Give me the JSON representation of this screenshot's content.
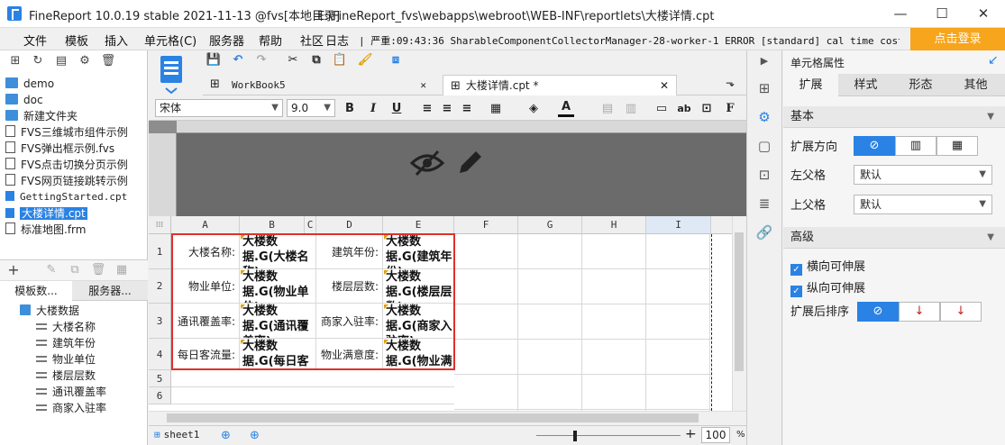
{
  "window": {
    "title": "FineReport 10.0.19 stable 2021-11-13 @fvs[本地目录]",
    "path": "E:\\FineReport_fvs\\webapps\\webroot\\WEB-INF\\reportlets\\大楼详情.cpt",
    "minimize": "—",
    "maximize": "☐",
    "close": "✕"
  },
  "menu": {
    "items": [
      "文件",
      "模板",
      "插入",
      "单元格(C)",
      "服务器",
      "帮助",
      "社区",
      "日志"
    ],
    "log": "| 严重:09:43:36 SharableComponentCollectorManager-28-worker-1 ERROR [standard] cal time cost...",
    "login": "点击登录"
  },
  "file_tree": {
    "items": [
      {
        "label": "demo",
        "type": "folder"
      },
      {
        "label": "doc",
        "type": "folder"
      },
      {
        "label": "新建文件夹",
        "type": "folder"
      },
      {
        "label": "FVS三维城市组件示例",
        "type": "file"
      },
      {
        "label": "FVS弹出框示例.fvs",
        "type": "file"
      },
      {
        "label": "FVS点击切换分页示例",
        "type": "file"
      },
      {
        "label": "FVS网页链接跳转示例",
        "type": "file"
      },
      {
        "label": "GettingStarted.cpt",
        "type": "cpt"
      },
      {
        "label": "大楼详情.cpt",
        "type": "cpt",
        "selected": true
      },
      {
        "label": "标准地图.frm",
        "type": "file"
      }
    ]
  },
  "dataset_panel": {
    "tabs": [
      "模板数...",
      "服务器..."
    ],
    "root": "大楼数据",
    "fields": [
      "大楼名称",
      "建筑年份",
      "物业单位",
      "楼层层数",
      "通讯覆盖率",
      "商家入驻率"
    ]
  },
  "doc_tabs": [
    {
      "label": "WorkBook5",
      "active": false
    },
    {
      "label": "大楼详情.cpt *",
      "active": true
    }
  ],
  "format": {
    "font": "宋体",
    "size": "9.0",
    "bold": "B",
    "italic": "I",
    "underline": "U"
  },
  "grid": {
    "columns": [
      "A",
      "B",
      "C",
      "D",
      "E",
      "F",
      "G",
      "H",
      "I"
    ],
    "rows": [
      "1",
      "2",
      "3",
      "4",
      "5",
      "6"
    ],
    "cells": [
      {
        "label_a": "大楼名称:",
        "formula_b": "大楼数据.G(大楼名称)",
        "label_d": "建筑年份:",
        "formula_e": "大楼数据.G(建筑年份)"
      },
      {
        "label_a": "物业单位:",
        "formula_b": "大楼数据.G(物业单位)",
        "label_d": "楼层层数:",
        "formula_e": "大楼数据.G(楼层层数)"
      },
      {
        "label_a": "通讯覆盖率:",
        "formula_b": "大楼数据.G(通讯覆盖率)",
        "label_d": "商家入驻率:",
        "formula_e": "大楼数据.G(商家入驻率)"
      },
      {
        "label_a": "每日客流量:",
        "formula_b": "大楼数据.G(每日客流量)",
        "label_d": "物业满意度:",
        "formula_e": "大楼数据.G(物业满意度)"
      }
    ]
  },
  "sheet": {
    "name": "sheet1",
    "zoom": "100",
    "zoom_unit": "%",
    "minus": "−",
    "plus": "+"
  },
  "properties": {
    "title": "单元格属性",
    "tabs": [
      "扩展",
      "样式",
      "形态",
      "其他"
    ],
    "basic": "基本",
    "expand_direction": "扩展方向",
    "left_parent": "左父格",
    "left_parent_value": "默认",
    "top_parent": "上父格",
    "top_parent_value": "默认",
    "advanced": "高级",
    "h_stretch": "横向可伸展",
    "v_stretch": "纵向可伸展",
    "sort_after": "扩展后排序"
  },
  "colors": {
    "accent": "#2a82e4",
    "login": "#f7a51c",
    "selection_border": "#e0302a"
  }
}
